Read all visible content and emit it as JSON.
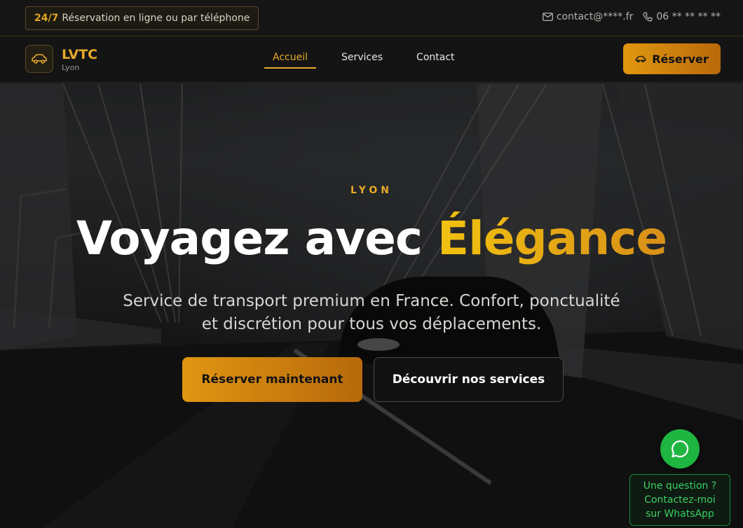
{
  "topbar": {
    "badge_accent": "24/7",
    "badge_text": "Réservation en ligne ou par téléphone",
    "email": "contact@****.fr",
    "phone": "06 ** ** ** **"
  },
  "nav": {
    "brand": "LVTC",
    "city": "Lyon",
    "links": [
      {
        "label": "Accueil",
        "active": true
      },
      {
        "label": "Services",
        "active": false
      },
      {
        "label": "Contact",
        "active": false
      }
    ],
    "reserve_label": "Réserver"
  },
  "hero": {
    "kicker": "LYON",
    "title_main": "Voyagez avec ",
    "title_accent": "Élégance",
    "subtitle": "Service de transport premium en France. Confort, ponctualité et discrétion pour tous vos déplacements.",
    "primary_cta": "Réserver maintenant",
    "secondary_cta": "Découvrir nos services"
  },
  "whatsapp": {
    "bubble_text": "Une question ? Contactez-moi sur WhatsApp"
  },
  "colors": {
    "accent": "#e6a92a",
    "whatsapp_green": "#1fb541"
  },
  "icons": [
    "car-icon",
    "mail-icon",
    "phone-icon",
    "whatsapp-icon"
  ]
}
